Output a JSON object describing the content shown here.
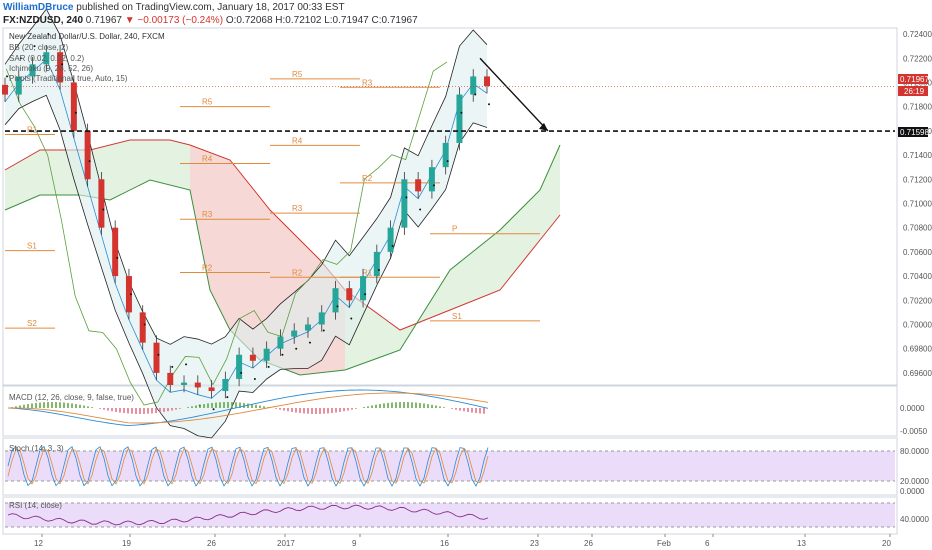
{
  "header": {
    "author": "WilliamDBruce",
    "published": " published on TradingView.com, January 18, 2017 00:33 EST",
    "symbol": "FX:NZDUSD, 240",
    "last": "0.71967",
    "change": "▼ −0.00173 (−0.24%)",
    "ohlc": "O:0.72068 H:0.72102 L:0.71947 C:0.71967"
  },
  "indicators": {
    "title": "New Zealand Dollar/U.S. Dollar, 240, FXCM",
    "bb": "BB (20, close, 2)",
    "sar": "SAR (0.02, 0.02, 0.2)",
    "ichimoku": "Ichimoku (9, 26, 52, 26)",
    "pivots": "Pivots (Traditional, true, Auto, 15)",
    "macd": "MACD (12, 26, close, 9, false, true)",
    "stoch": "Stoch (14, 3, 3)",
    "rsi": "RSI (14, close)"
  },
  "price_labels": {
    "last": "0.71967",
    "countdown": "26:19",
    "level": "0.71598"
  },
  "colors": {
    "up": "#26a69a",
    "down": "#d3342f",
    "pivot": "#e08a3c",
    "kumo_bull": "#d9ecd6",
    "kumo_bear": "#f2c9c6",
    "bb_fill": "#dfeeef",
    "panel_fill": "#e6d4f7"
  },
  "chart_data": [
    {
      "type": "candlestick",
      "title": "New Zealand Dollar/U.S. Dollar, 240, FXCM",
      "ylim": [
        0.695,
        0.7245
      ],
      "y_ticks": [
        "0.72400",
        "0.72200",
        "0.72000",
        "0.71800",
        "0.71600",
        "0.71400",
        "0.71200",
        "0.71000",
        "0.70800",
        "0.70600",
        "0.70400",
        "0.70200",
        "0.70000",
        "0.69800",
        "0.69600"
      ],
      "x_ticks": [
        "12",
        "19",
        "26",
        "2017",
        "9",
        "16",
        "23",
        "26",
        "Feb",
        "6",
        "13",
        "20"
      ],
      "close_path": [
        0.719,
        0.7205,
        0.7215,
        0.7225,
        0.72,
        0.716,
        0.712,
        0.708,
        0.704,
        0.701,
        0.6985,
        0.696,
        0.695,
        0.6952,
        0.6948,
        0.6945,
        0.6955,
        0.6975,
        0.697,
        0.698,
        0.699,
        0.6995,
        0.7,
        0.701,
        0.703,
        0.702,
        0.704,
        0.706,
        0.708,
        0.712,
        0.711,
        0.713,
        0.715,
        0.719,
        0.7205,
        0.7197
      ],
      "pivot_levels": [
        {
          "label": "R1",
          "value": 0.7157
        },
        {
          "label": "S1",
          "value": 0.7061
        },
        {
          "label": "S2",
          "value": 0.6997
        },
        {
          "label": "R5",
          "value": 0.718
        },
        {
          "label": "R4",
          "value": 0.7133
        },
        {
          "label": "R3",
          "value": 0.7087
        },
        {
          "label": "R2",
          "value": 0.7043
        },
        {
          "label": "R5",
          "value": 0.7203
        },
        {
          "label": "R4",
          "value": 0.7148
        },
        {
          "label": "R3",
          "value": 0.7092
        },
        {
          "label": "R2",
          "value": 0.7039
        },
        {
          "label": "R3",
          "value": 0.7196
        },
        {
          "label": "R2",
          "value": 0.7117
        },
        {
          "label": "R1",
          "value": 0.7039
        },
        {
          "label": "P",
          "value": 0.7075
        },
        {
          "label": "S1",
          "value": 0.7003
        }
      ],
      "horizontal_line": 0.71598,
      "projection_arrow": {
        "from": 0.722,
        "to": 0.716
      }
    },
    {
      "type": "line",
      "title": "MACD (12, 26, close, 9, false, true)",
      "y_ticks": [
        "0.0000",
        "-0.0050"
      ],
      "series": [
        {
          "name": "MACD"
        },
        {
          "name": "Signal"
        },
        {
          "name": "Histogram"
        }
      ]
    },
    {
      "type": "line",
      "title": "Stoch (14, 3, 3)",
      "y_ticks": [
        "80.0000",
        "20.0000",
        "0.0000"
      ],
      "band": [
        20,
        80
      ]
    },
    {
      "type": "line",
      "title": "RSI (14, close)",
      "y_ticks": [
        "40.0000"
      ],
      "band": [
        30,
        70
      ]
    }
  ]
}
